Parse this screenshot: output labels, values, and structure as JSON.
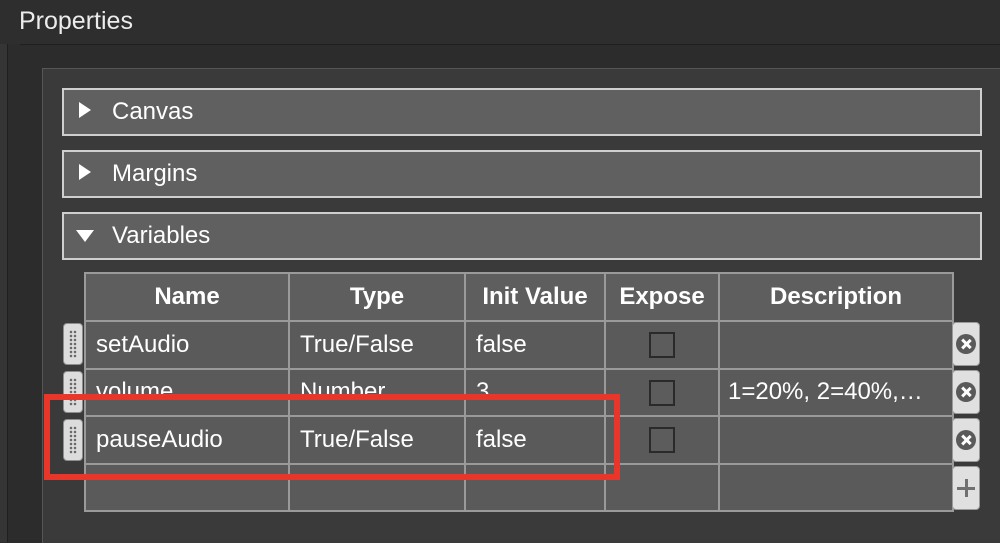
{
  "header": {
    "title": "Properties"
  },
  "sections": [
    {
      "label": "Canvas",
      "expanded": false
    },
    {
      "label": "Margins",
      "expanded": false
    },
    {
      "label": "Variables",
      "expanded": true
    }
  ],
  "variables": {
    "columns": [
      "Name",
      "Type",
      "Init Value",
      "Expose",
      "Description"
    ],
    "rows": [
      {
        "name": "setAudio",
        "type": "True/False",
        "init": "false",
        "expose": false,
        "description": ""
      },
      {
        "name": "volume",
        "type": "Number",
        "init": "3",
        "expose": false,
        "description": "1=20%, 2=40%,…"
      },
      {
        "name": "pauseAudio",
        "type": "True/False",
        "init": "false",
        "expose": false,
        "description": ""
      }
    ]
  },
  "colors": {
    "background": "#2c2c2c",
    "section_fill": "#606060",
    "highlight": "#e8372a"
  },
  "icons": [
    "drag-handle-icon",
    "remove-circle-icon",
    "add-plus-icon",
    "disclosure-triangle-icon"
  ]
}
